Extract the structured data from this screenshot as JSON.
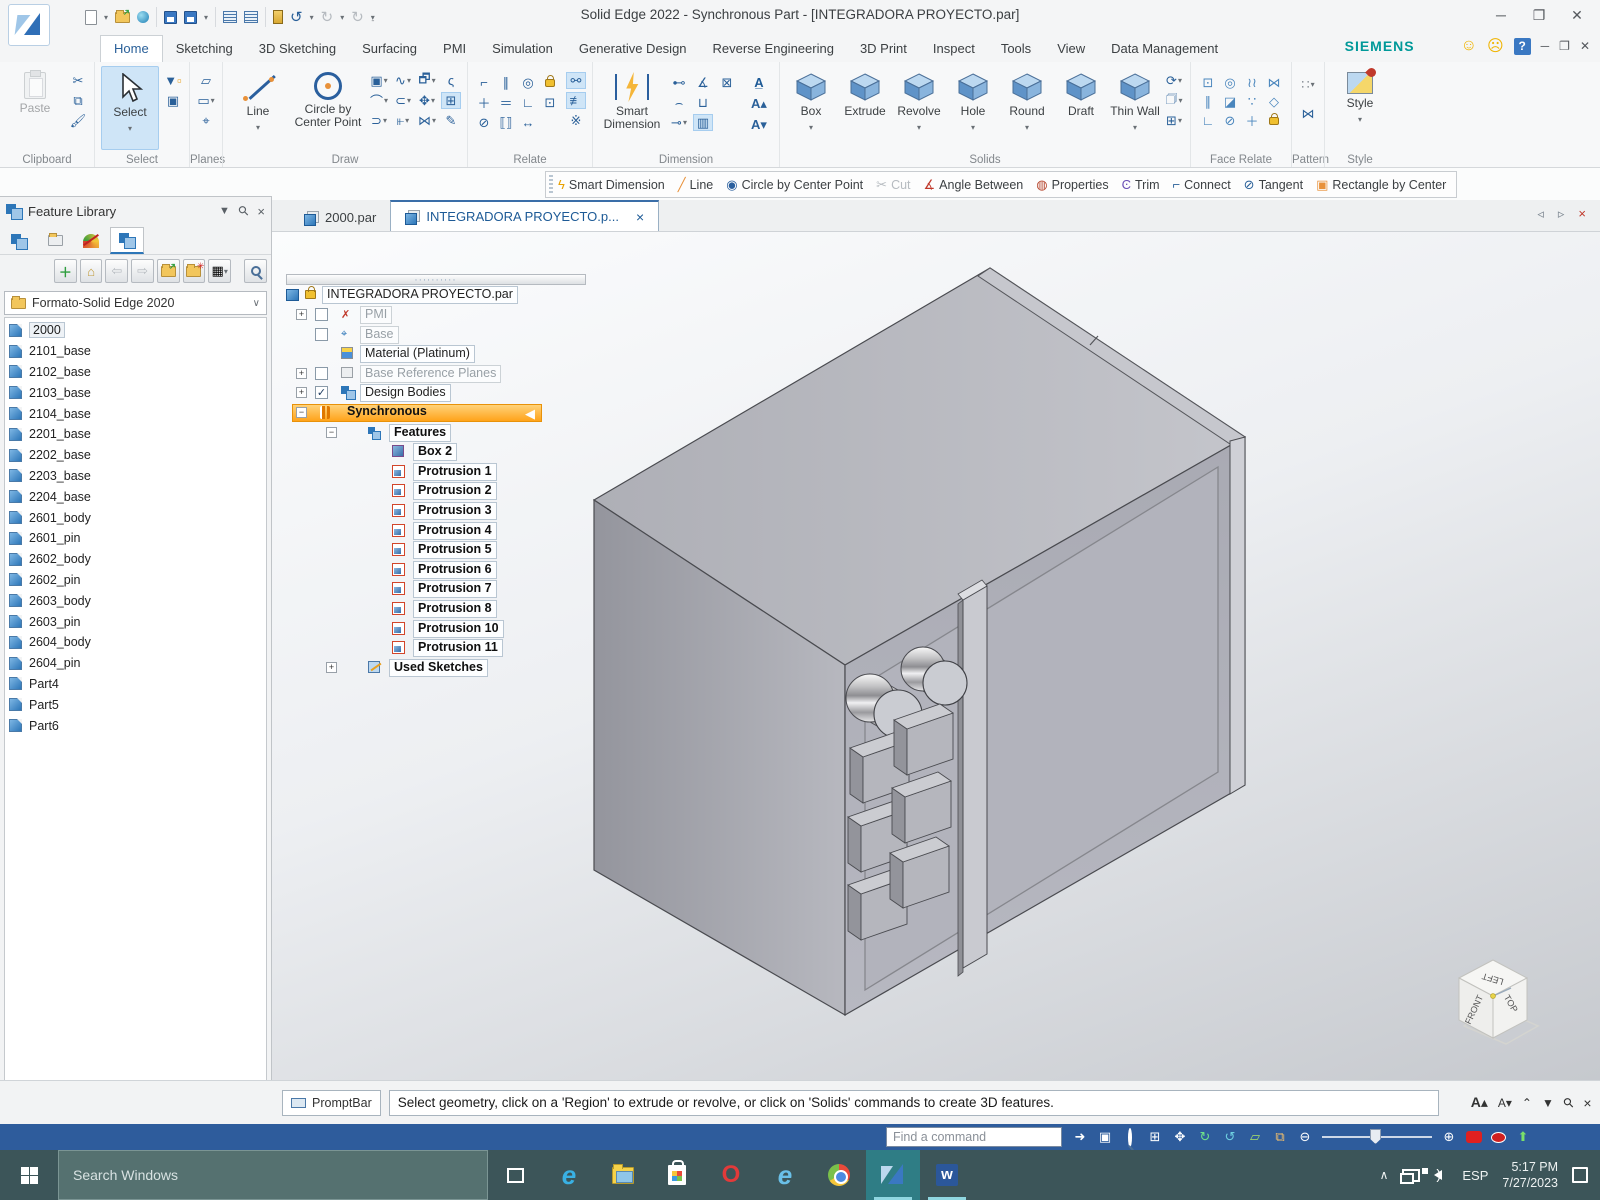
{
  "window": {
    "title": "Solid Edge 2022 - Synchronous Part - [INTEGRADORA PROYECTO.par]",
    "brand": "SIEMENS"
  },
  "ribbon_tabs": [
    {
      "label": "Home",
      "active": true
    },
    {
      "label": "Sketching"
    },
    {
      "label": "3D Sketching"
    },
    {
      "label": "Surfacing"
    },
    {
      "label": "PMI"
    },
    {
      "label": "Simulation"
    },
    {
      "label": "Generative Design"
    },
    {
      "label": "Reverse Engineering"
    },
    {
      "label": "3D Print"
    },
    {
      "label": "Inspect"
    },
    {
      "label": "Tools"
    },
    {
      "label": "View"
    },
    {
      "label": "Data Management"
    }
  ],
  "ribbon": {
    "clipboard": {
      "label": "Clipboard",
      "paste": "Paste"
    },
    "select": {
      "label": "Select",
      "select": "Select"
    },
    "planes": {
      "label": "Planes"
    },
    "draw": {
      "label": "Draw",
      "line": "Line",
      "circle": "Circle by Center Point"
    },
    "relate": {
      "label": "Relate"
    },
    "dimension": {
      "label": "Dimension",
      "smart": "Smart Dimension"
    },
    "solids": {
      "label": "Solids",
      "buttons": [
        "Box",
        "Extrude",
        "Revolve",
        "Hole",
        "Round",
        "Draft",
        "Thin Wall"
      ]
    },
    "face_relate": {
      "label": "Face Relate"
    },
    "pattern": {
      "label": "Pattern"
    },
    "style": {
      "label": "Style",
      "style": "Style"
    }
  },
  "context_toolbar": [
    {
      "label": "Smart Dimension",
      "icon": "smart-dimension"
    },
    {
      "label": "Line",
      "icon": "line"
    },
    {
      "label": "Circle by Center Point",
      "icon": "circle-center"
    },
    {
      "label": "Cut",
      "icon": "cut",
      "disabled": true
    },
    {
      "label": "Angle Between",
      "icon": "angle-between"
    },
    {
      "label": "Properties",
      "icon": "properties"
    },
    {
      "label": "Trim",
      "icon": "trim"
    },
    {
      "label": "Connect",
      "icon": "connect"
    },
    {
      "label": "Tangent",
      "icon": "tangent"
    },
    {
      "label": "Rectangle by Center",
      "icon": "rectangle-center"
    }
  ],
  "document_tabs": [
    {
      "label": "2000.par"
    },
    {
      "label": "INTEGRADORA PROYECTO.p...",
      "active": true,
      "closable": true
    }
  ],
  "feature_library": {
    "title": "Feature Library",
    "folder": "Formato-Solid Edge 2020",
    "selected": "2000",
    "items": [
      "2000",
      "2101_base",
      "2102_base",
      "2103_base",
      "2104_base",
      "2201_base",
      "2202_base",
      "2203_base",
      "2204_base",
      "2601_body",
      "2601_pin",
      "2602_body",
      "2602_pin",
      "2603_body",
      "2603_pin",
      "2604_body",
      "2604_pin",
      "Part4",
      "Part5",
      "Part6"
    ]
  },
  "pathfinder": {
    "root": "INTEGRADORA PROYECTO.par",
    "nodes": [
      {
        "label": "PMI",
        "level": 1,
        "expand": "plus",
        "check": "off",
        "icon": "pmi",
        "variant": "gray"
      },
      {
        "label": "Base",
        "level": 1,
        "expand": null,
        "check": "off",
        "icon": "base",
        "variant": "gray"
      },
      {
        "label": "Material (Platinum)",
        "level": 1,
        "expand": null,
        "check": null,
        "icon": "material",
        "variant": "normal"
      },
      {
        "label": "Base Reference Planes",
        "level": 1,
        "expand": "plus",
        "check": "off",
        "icon": "planes",
        "variant": "gray"
      },
      {
        "label": "Design Bodies",
        "level": 1,
        "expand": "plus",
        "check": "on",
        "icon": "bodies",
        "variant": "normal"
      },
      {
        "label": "Synchronous",
        "level": 1,
        "expand": "minus",
        "check": null,
        "icon": "sync",
        "variant": "sync"
      },
      {
        "label": "Features",
        "level": 2,
        "expand": "minus",
        "check": null,
        "icon": "features",
        "variant": "bold"
      },
      {
        "label": "Box 2",
        "level": 3,
        "expand": null,
        "check": null,
        "icon": "box",
        "variant": "bold"
      },
      {
        "label": "Protrusion 1",
        "level": 3,
        "expand": null,
        "check": null,
        "icon": "protrusion",
        "variant": "bold"
      },
      {
        "label": "Protrusion 2",
        "level": 3,
        "expand": null,
        "check": null,
        "icon": "protrusion",
        "variant": "bold"
      },
      {
        "label": "Protrusion 3",
        "level": 3,
        "expand": null,
        "check": null,
        "icon": "protrusion",
        "variant": "bold"
      },
      {
        "label": "Protrusion 4",
        "level": 3,
        "expand": null,
        "check": null,
        "icon": "protrusion",
        "variant": "bold"
      },
      {
        "label": "Protrusion 5",
        "level": 3,
        "expand": null,
        "check": null,
        "icon": "protrusion",
        "variant": "bold"
      },
      {
        "label": "Protrusion 6",
        "level": 3,
        "expand": null,
        "check": null,
        "icon": "protrusion",
        "variant": "bold"
      },
      {
        "label": "Protrusion 7",
        "level": 3,
        "expand": null,
        "check": null,
        "icon": "protrusion",
        "variant": "bold"
      },
      {
        "label": "Protrusion 8",
        "level": 3,
        "expand": null,
        "check": null,
        "icon": "protrusion",
        "variant": "bold"
      },
      {
        "label": "Protrusion 10",
        "level": 3,
        "expand": null,
        "check": null,
        "icon": "protrusion",
        "variant": "bold"
      },
      {
        "label": "Protrusion 11",
        "level": 3,
        "expand": null,
        "check": null,
        "icon": "protrusion",
        "variant": "bold"
      },
      {
        "label": "Used Sketches",
        "level": 2,
        "expand": "plus",
        "check": null,
        "icon": "sketches",
        "variant": "bold"
      }
    ]
  },
  "viewport": {
    "view_cube": {
      "top": "LEFT",
      "left": "FRONT",
      "right": "TOP"
    }
  },
  "prompt_bar": {
    "label": "PromptBar",
    "message": "Select geometry, click on a 'Region' to extrude or revolve, or click on 'Solids' commands to create 3D features."
  },
  "command_bar": {
    "placeholder": "Find a command"
  },
  "taskbar": {
    "search_placeholder": "Search Windows",
    "language": "ESP",
    "time": "5:17 PM",
    "date": "7/27/2023",
    "apps": [
      "task-view",
      "edge",
      "file-explorer",
      "store",
      "opera",
      "internet-explorer",
      "chrome",
      "solid-edge",
      "word"
    ]
  }
}
